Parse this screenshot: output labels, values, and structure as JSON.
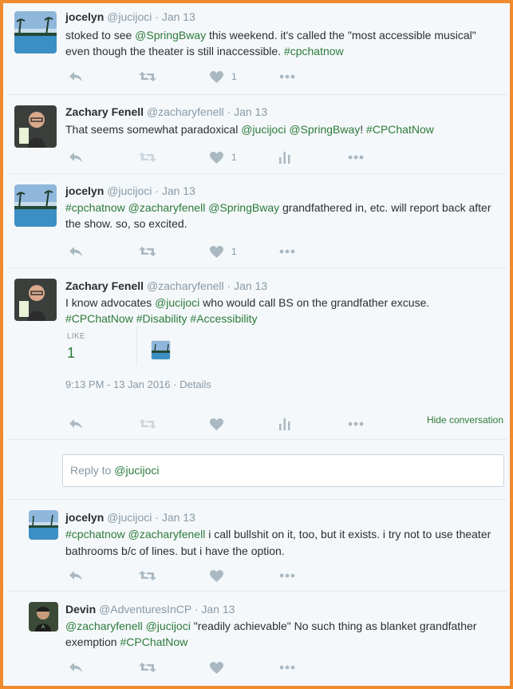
{
  "tweets": [
    {
      "name": "jocelyn",
      "handle": "@jucijoci",
      "sep": "·",
      "date": "Jan 13",
      "text": [
        {
          "t": "stoked to see "
        },
        {
          "t": "@SpringBway",
          "link": true
        },
        {
          "t": " this weekend. it's called the \"most accessible musical\" even though the theater is still inaccessible. "
        },
        {
          "t": "#cpchatnow",
          "link": true
        }
      ],
      "like_count": "1"
    },
    {
      "name": "Zachary Fenell",
      "handle": "@zacharyfenell",
      "sep": "·",
      "date": "Jan 13",
      "text": [
        {
          "t": "That seems somewhat paradoxical "
        },
        {
          "t": "@jucijoci",
          "link": true
        },
        {
          "t": " "
        },
        {
          "t": "@SpringBway",
          "link": true
        },
        {
          "t": "! "
        },
        {
          "t": "#CPChatNow",
          "link": true
        }
      ],
      "like_count": "1"
    },
    {
      "name": "jocelyn",
      "handle": "@jucijoci",
      "sep": "·",
      "date": "Jan 13",
      "text": [
        {
          "t": "#cpchatnow",
          "link": true
        },
        {
          "t": " "
        },
        {
          "t": "@zacharyfenell",
          "link": true
        },
        {
          "t": " "
        },
        {
          "t": "@SpringBway",
          "link": true
        },
        {
          "t": " grandfathered in, etc. will report back after the show. so, so excited."
        }
      ],
      "like_count": "1"
    },
    {
      "name": "Zachary Fenell",
      "handle": "@zacharyfenell",
      "sep": "·",
      "date": "Jan 13",
      "text": [
        {
          "t": "I know advocates "
        },
        {
          "t": "@jucijoci",
          "link": true
        },
        {
          "t": " who would call BS on the grandfather excuse. "
        },
        {
          "t": "#CPChatNow",
          "link": true
        },
        {
          "t": " "
        },
        {
          "t": "#Disability",
          "link": true
        },
        {
          "t": " "
        },
        {
          "t": "#Accessibility",
          "link": true
        }
      ],
      "like_label": "LIKE",
      "like_count": "1",
      "timestamp": "9:13 PM - 13 Jan 2016",
      "details": "Details",
      "hide": "Hide conversation"
    },
    {
      "name": "jocelyn",
      "handle": "@jucijoci",
      "sep": "·",
      "date": "Jan 13",
      "text": [
        {
          "t": "#cpchatnow",
          "link": true
        },
        {
          "t": " "
        },
        {
          "t": "@zacharyfenell",
          "link": true
        },
        {
          "t": " i call bullshit on it, too, but it exists. i try not to use theater bathrooms b/c of lines. but i have the option."
        }
      ]
    },
    {
      "name": "Devin",
      "handle": "@AdventuresInCP",
      "sep": "·",
      "date": "Jan 13",
      "text": [
        {
          "t": "@zacharyfenell",
          "link": true
        },
        {
          "t": " "
        },
        {
          "t": "@jucijoci",
          "link": true
        },
        {
          "t": " \"readily achievable\" No such thing as blanket grandfather exemption "
        },
        {
          "t": "#CPChatNow",
          "link": true
        }
      ]
    }
  ],
  "reply": {
    "prefix": "Reply to ",
    "mention": "@jucijoci"
  },
  "icons": [
    "reply-icon",
    "retweet-icon",
    "heart-icon",
    "analytics-icon",
    "more-icon"
  ],
  "colors": {
    "border": "#f08a2e",
    "link": "#2b7a3b",
    "muted": "#8899a6",
    "icon": "#aab8c2",
    "background": "#f5f8fa"
  }
}
